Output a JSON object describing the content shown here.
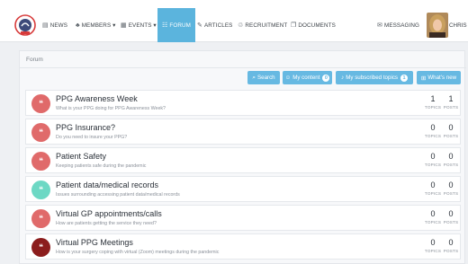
{
  "nav": {
    "items": [
      {
        "label": "NEWS",
        "icon": "news-icon",
        "glyph": "▤"
      },
      {
        "label": "MEMBERS ▾",
        "icon": "members-icon",
        "glyph": "♣"
      },
      {
        "label": "EVENTS ▾",
        "icon": "calendar-icon",
        "glyph": "▦"
      },
      {
        "label": "FORUM",
        "icon": "forum-icon",
        "glyph": "☷",
        "active": true
      },
      {
        "label": "ARTICLES",
        "icon": "pencil-icon",
        "glyph": "✎"
      },
      {
        "label": "RECRUITMENT",
        "icon": "bulb-icon",
        "glyph": "♲"
      },
      {
        "label": "DOCUMENTS",
        "icon": "documents-icon",
        "glyph": "❐"
      },
      {
        "label": "MESSAGING",
        "icon": "chat-icon",
        "glyph": "✉"
      }
    ],
    "user": "CHRIS ▾"
  },
  "breadcrumb": "Forum",
  "buttons": [
    {
      "label": "Search",
      "glyph": "⌕"
    },
    {
      "label": "My content",
      "glyph": "☺",
      "count": "0"
    },
    {
      "label": "My subscribed topics",
      "glyph": "♪",
      "count": "1"
    },
    {
      "label": "What's new",
      "glyph": "⊞"
    }
  ],
  "stat_labels": {
    "topics": "TOPICS",
    "posts": "POSTS"
  },
  "forums": [
    {
      "title": "PPG Awareness Week",
      "subtitle": "What is your PPG doing for PPG Awareness Week?",
      "topics": "1",
      "posts": "1",
      "color": "#e06a6a"
    },
    {
      "title": "PPG Insurance?",
      "subtitle": "Do you need to insure your PPG?",
      "topics": "0",
      "posts": "0",
      "color": "#e06a6a"
    },
    {
      "title": "Patient Safety",
      "subtitle": "Keeping patients safe during the pandemic",
      "topics": "0",
      "posts": "0",
      "color": "#e06a6a"
    },
    {
      "title": "Patient data/medical records",
      "subtitle": "Issues surrounding accessing patient data/medical records",
      "topics": "0",
      "posts": "0",
      "color": "#6dd8c4"
    },
    {
      "title": "Virtual GP appointments/calls",
      "subtitle": "How are patients getting the service they need?",
      "topics": "0",
      "posts": "0",
      "color": "#e06a6a"
    },
    {
      "title": "Virtual PPG Meetings",
      "subtitle": "How is your surgery coping with virtual (Zoom) meetings during the pandemic",
      "topics": "0",
      "posts": "0",
      "color": "#8b1c1c"
    }
  ]
}
